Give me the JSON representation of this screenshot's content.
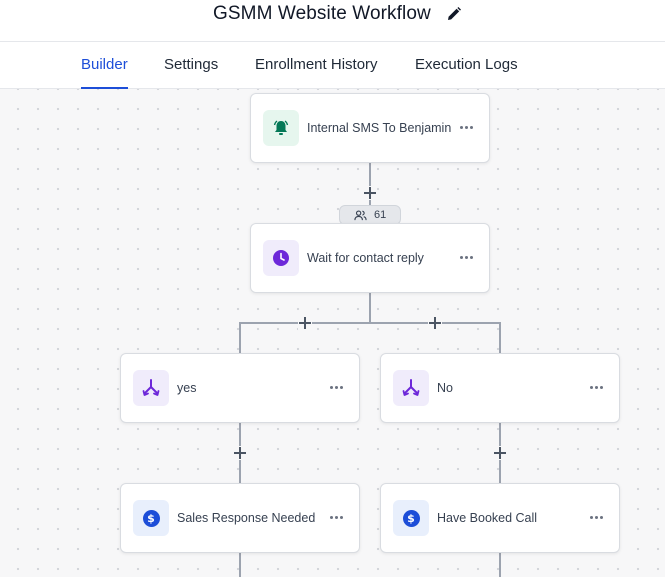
{
  "header": {
    "title": "GSMM Website Workflow",
    "edit_icon": "pencil-icon"
  },
  "tabs": [
    {
      "label": "Builder",
      "active": true
    },
    {
      "label": "Settings",
      "active": false
    },
    {
      "label": "Enrollment History",
      "active": false
    },
    {
      "label": "Execution Logs",
      "active": false
    }
  ],
  "workflow": {
    "nodes": [
      {
        "label": "Internal SMS To Benjamin",
        "icon": "bell-icon"
      },
      {
        "label": "Wait for contact reply",
        "icon": "clock-icon"
      },
      {
        "label": "yes",
        "icon": "branch-icon"
      },
      {
        "label": "No",
        "icon": "branch-icon"
      },
      {
        "label": "Sales Response Needed",
        "icon": "dollar-icon"
      },
      {
        "label": "Have Booked Call",
        "icon": "dollar-icon"
      }
    ],
    "contact_count": "61"
  },
  "colors": {
    "accent": "#1d4ed8",
    "purple": "#6d28d9",
    "green": "#047857"
  }
}
